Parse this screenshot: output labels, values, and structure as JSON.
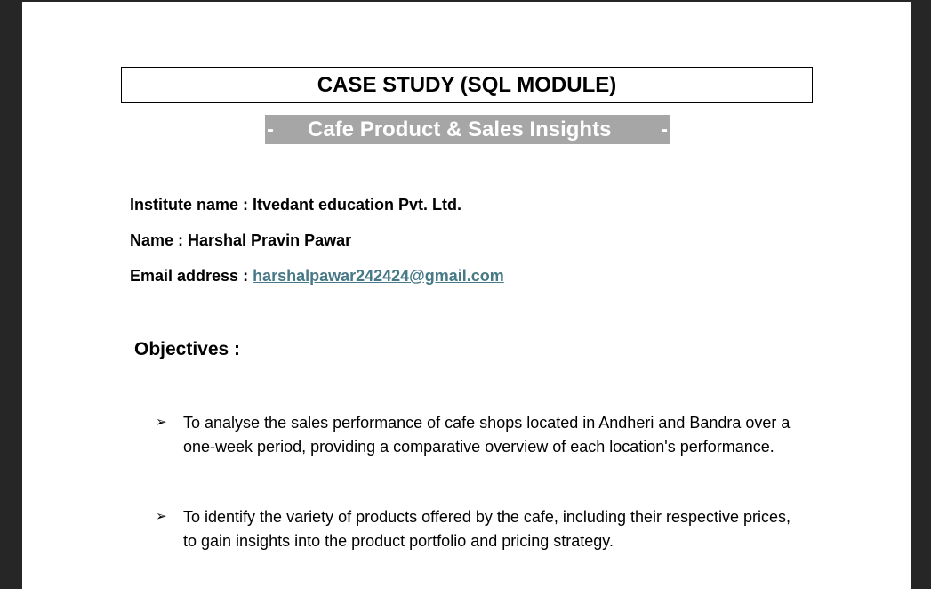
{
  "document": {
    "title": "CASE STUDY (SQL MODULE)",
    "subtitle": {
      "dash_left": "-",
      "text": "Cafe Product & Sales Insights",
      "dash_right": "-"
    },
    "info": {
      "institute": "Institute name : Itvedant education Pvt. Ltd.",
      "name": "Name : Harshal Pravin Pawar",
      "email_label": "Email address : ",
      "email": "harshalpawar242424@gmail.com"
    },
    "objectives_heading": "Objectives :",
    "bullet_symbol": "➢",
    "objectives": [
      "To analyse the sales performance of cafe shops located in Andheri and Bandra over a one-week period, providing a comparative overview of each location's performance.",
      "To identify the variety of products offered by the cafe, including their respective prices, to gain insights into the product portfolio and pricing strategy."
    ]
  },
  "colors": {
    "background": "#262626",
    "page": "#ffffff",
    "subtitle_bar": "#a6a6a6",
    "link": "#467886"
  }
}
